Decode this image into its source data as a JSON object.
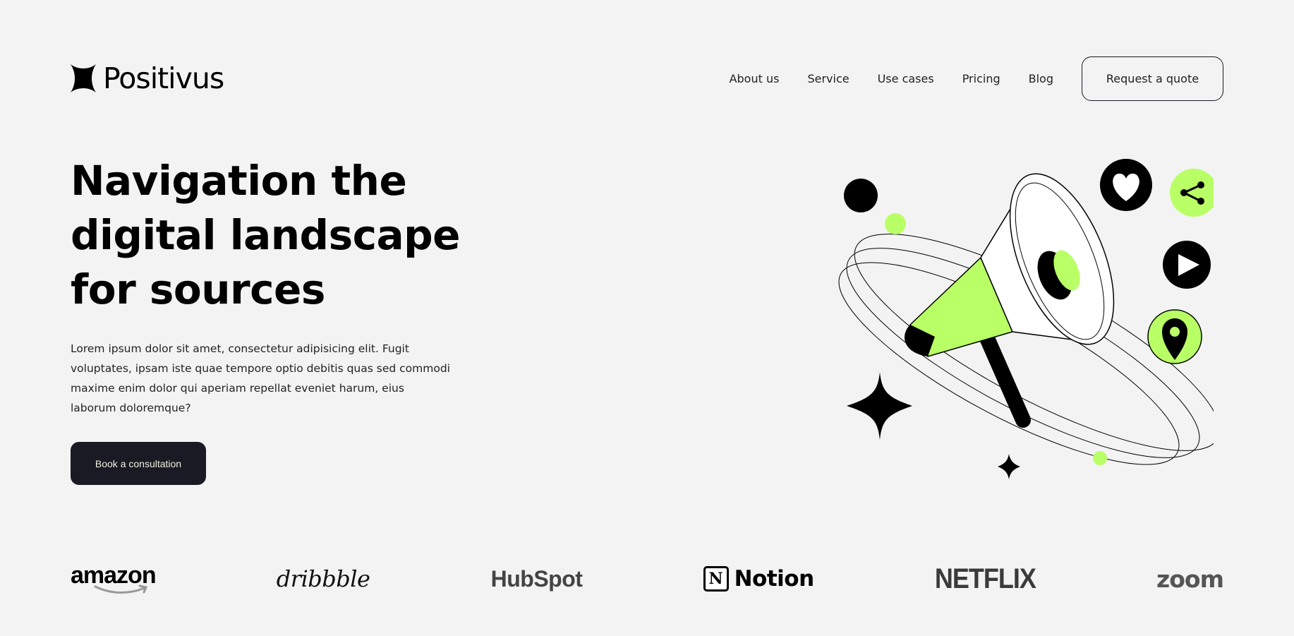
{
  "brand": {
    "name": "Positivus",
    "icon": "star-logo-icon"
  },
  "nav": {
    "items": [
      {
        "label": "About us"
      },
      {
        "label": "Service"
      },
      {
        "label": "Use cases"
      },
      {
        "label": "Pricing"
      },
      {
        "label": "Blog"
      }
    ],
    "cta_label": "Request a quote"
  },
  "hero": {
    "title_lines": [
      "Navigation the",
      "digital landscape",
      "for sources"
    ],
    "description": "Lorem ipsum dolor sit amet, consectetur adipisicing elit. Fugit voluptates, ipsam iste quae tempore optio debitis quas sed commodi maxime enim dolor qui aperiam repellat eveniet harum, eius laborum doloremque?",
    "cta_label": "Book a consultation",
    "illustration": {
      "name": "megaphone-illustration",
      "icons": [
        "heart-icon",
        "share-icon",
        "play-icon",
        "location-pin-icon",
        "sparkle-star-icon"
      ]
    }
  },
  "brands": [
    {
      "name": "amazon"
    },
    {
      "name": "dribbble"
    },
    {
      "name": "HubSpot"
    },
    {
      "name": "Notion"
    },
    {
      "name": "NETFLIX"
    },
    {
      "name": "zoom"
    }
  ],
  "colors": {
    "background": "#f3f3f3",
    "accent": "#b9ff66",
    "dark": "#191a23"
  }
}
